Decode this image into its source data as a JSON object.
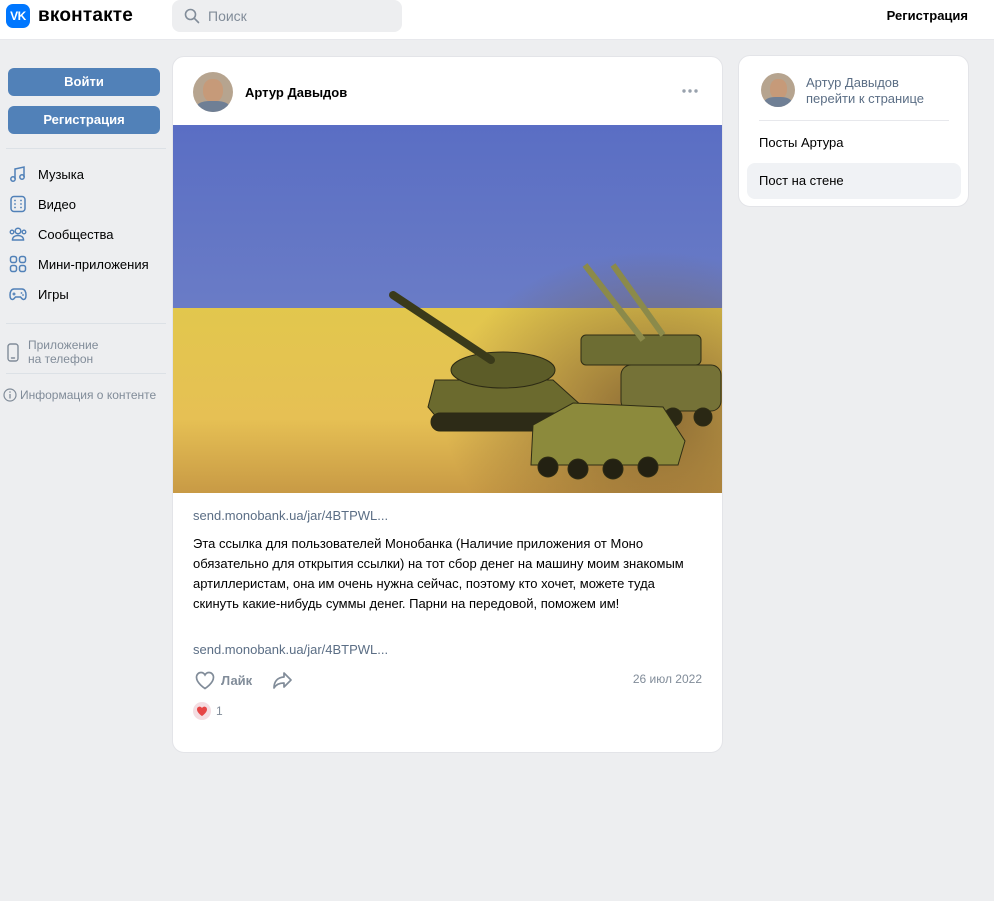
{
  "header": {
    "logo_text": "вконтакте",
    "logo_mark": "VK",
    "search_placeholder": "Поиск",
    "register_link": "Регистрация"
  },
  "sidebar": {
    "login_button": "Войти",
    "register_button": "Регистрация",
    "menu": [
      {
        "label": "Музыка",
        "icon": "music-icon"
      },
      {
        "label": "Видео",
        "icon": "video-icon"
      },
      {
        "label": "Сообщества",
        "icon": "communities-icon"
      },
      {
        "label": "Мини-приложения",
        "icon": "mini-apps-icon"
      },
      {
        "label": "Игры",
        "icon": "games-icon"
      }
    ],
    "app_link_line1": "Приложение",
    "app_link_line2": "на телефон",
    "info_link": "Информация о контенте"
  },
  "post": {
    "author": "Артур Давыдов",
    "link_top": "send.monobank.ua/jar/4BTPWL...",
    "text": "Эта ссылка для пользователей Монобанка (Наличие приложения от Моно обязательно для открытия ссылки) на тот сбор денег на машину моим знакомым артиллеристам, она им очень нужна сейчас, поэтому кто хочет, можете туда скинуть какие-нибудь суммы денег. Парни на передовой, поможем им!",
    "link_bottom": "send.monobank.ua/jar/4BTPWL...",
    "like_label": "Лайк",
    "date": "26 июл 2022",
    "reactions_count": "1"
  },
  "right_card": {
    "author_name": "Артур Давыдов",
    "go_to_page": "перейти к странице",
    "posts_item": "Посты Артура",
    "wall_item": "Пост на стене"
  },
  "colors": {
    "accent": "#5181b8",
    "link": "#5b6e85",
    "muted": "#818c99",
    "background": "#edeef0",
    "flag_blue": "#5b6fc3",
    "flag_yellow": "#e8c84a"
  }
}
